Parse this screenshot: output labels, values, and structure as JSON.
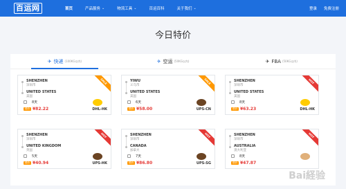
{
  "nav": {
    "logo": "百运网",
    "items": [
      {
        "label": "首页",
        "active": true,
        "dropdown": false
      },
      {
        "label": "产品服务",
        "active": false,
        "dropdown": true
      },
      {
        "label": "物流工具",
        "active": false,
        "dropdown": true
      },
      {
        "label": "百运百科",
        "active": false,
        "dropdown": false
      },
      {
        "label": "关于我们",
        "active": false,
        "dropdown": true
      }
    ],
    "login": "登录",
    "register": "免费注册"
  },
  "title": "今日特价",
  "tabs": [
    {
      "label": "快递",
      "sub": "(100KG以内)",
      "icon": "plane-icon",
      "active": true
    },
    {
      "label": "空运",
      "sub": "(50KG以内)",
      "icon": "plane-icon",
      "active": false
    },
    {
      "label": "FBA",
      "sub": "(50KG以内)",
      "icon": "plane-icon",
      "active": false
    }
  ],
  "cards": [
    {
      "from": "SHENZHEN",
      "from_cn": "深圳市",
      "to": "UNITED STATES",
      "to_cn": "美国",
      "days": "8天",
      "tag": "低价",
      "price": "¥82.22",
      "carrier": "DHL-HK",
      "badge": "SALE",
      "logo_color": "#ffcc00"
    },
    {
      "from": "YIWU",
      "from_cn": "义乌市",
      "to": "UNITED STATES",
      "to_cn": "美国",
      "days": "6天",
      "tag": "低价",
      "price": "¥58.00",
      "carrier": "UPS-CN",
      "badge": "SALE",
      "logo_color": "#6b4423"
    },
    {
      "from": "SHENZHEN",
      "from_cn": "深圳市",
      "to": "UNITED STATES",
      "to_cn": "美国",
      "days": "8天",
      "tag": "低价",
      "price": "¥63.23",
      "carrier": "DHL-HK",
      "badge": "HOT",
      "logo_color": "#ffcc00"
    },
    {
      "from": "SHENZHEN",
      "from_cn": "深圳市",
      "to": "UNITED KINGDOM",
      "to_cn": "英国",
      "days": "5天",
      "tag": "低价",
      "price": "¥40.94",
      "carrier": "UPS-HK",
      "badge": "HOT",
      "logo_color": "#6b4423"
    },
    {
      "from": "SHENZHEN",
      "from_cn": "深圳市",
      "to": "CANADA",
      "to_cn": "加拿大",
      "days": "7天",
      "tag": "低价",
      "price": "¥86.80",
      "carrier": "UPS-SG",
      "badge": "HOT",
      "logo_color": "#6b4423"
    },
    {
      "from": "SHENZHEN",
      "from_cn": "深圳市",
      "to": "AUSTRALIA",
      "to_cn": "澳大利亚",
      "days": "8天",
      "tag": "低价",
      "price": "¥47.87",
      "carrier": "",
      "badge": "HOT",
      "logo_color": "#e0b07a"
    }
  ],
  "watermark": "Bai経验"
}
